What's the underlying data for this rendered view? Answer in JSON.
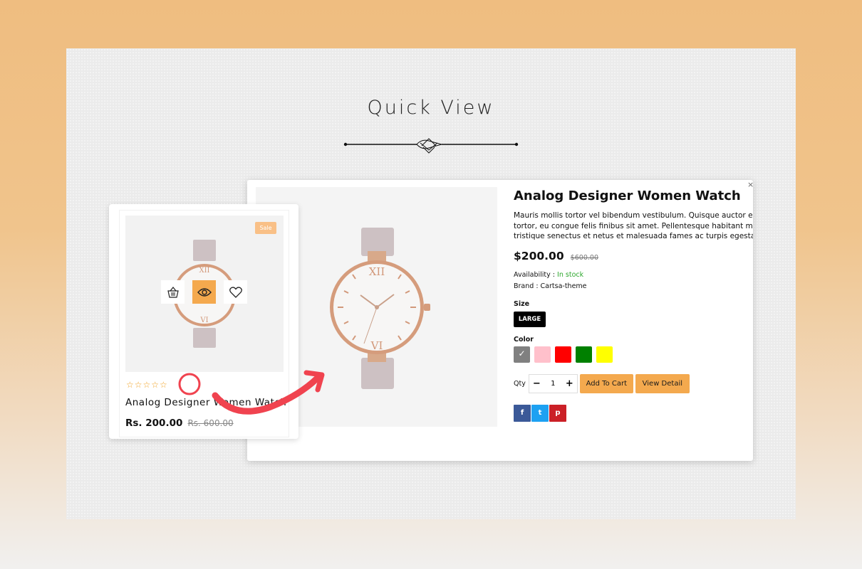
{
  "heading": "Quick View",
  "modal": {
    "title": "Analog Designer Women Watch",
    "description_lines": [
      "Mauris mollis tortor vel bibendum vestibulum. Quisque auctor euismod",
      "tortor, eu congue felis finibus sit amet. Pellentesque habitant morbi",
      "tristique senectus et netus et malesuada fames ac turpis egestas. Sed"
    ],
    "price": "$200.00",
    "old_price": "$600.00",
    "availability_label": "Availability :",
    "availability_value": "In stock",
    "brand": "Brand : Cartsa-theme",
    "size_label": "Size",
    "size_value": "LARGE",
    "color_label": "Color",
    "colors": [
      "#808080",
      "#ffc0cb",
      "#ff0000",
      "#008000",
      "#ffff00"
    ],
    "qty_label": "Qty",
    "qty_value": "1",
    "qty_minus": "−",
    "qty_plus": "+",
    "add_to_cart": "Add To Cart",
    "view_detail": "View Detail",
    "social": [
      {
        "name": "facebook-icon",
        "glyph": "f",
        "color": "#3b5998"
      },
      {
        "name": "twitter-icon",
        "glyph": "t",
        "color": "#1da1f2"
      },
      {
        "name": "pinterest-icon",
        "glyph": "p",
        "color": "#cb2027"
      }
    ]
  },
  "card": {
    "badge": "Sale",
    "stars": "☆☆☆☆☆",
    "title": "Analog Designer Women Watch",
    "price": "Rs. 200.00",
    "old_price": "Rs. 600.00"
  },
  "accent": "#f4a94e",
  "arrow_color": "#f0434f"
}
